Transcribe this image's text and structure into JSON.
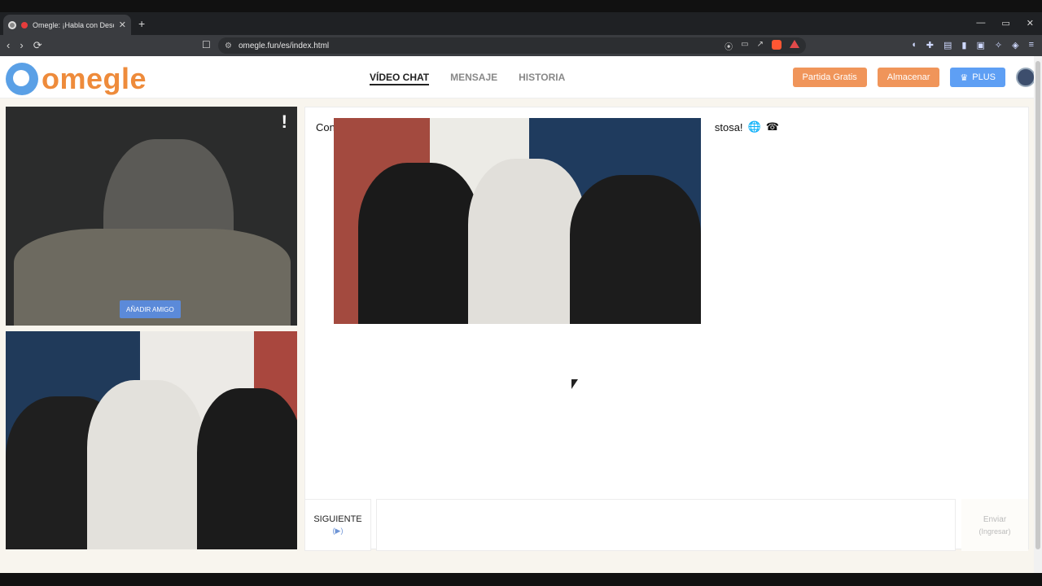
{
  "browser": {
    "tab_title": "Omegle: ¡Habla con Descono",
    "new_tab": "+",
    "url": "omegle.fun/es/index.html"
  },
  "header": {
    "logo_text": "omegle",
    "menu": [
      {
        "label": "VÍDEO CHAT"
      },
      {
        "label": "MENSAJE"
      },
      {
        "label": "HISTORIA"
      }
    ],
    "buttons": {
      "free_game": "Partida Gratis",
      "store": "Almacenar",
      "plus": "PLUS"
    }
  },
  "self_video": {
    "report_symbol": "!",
    "add_friend_label": "AÑADIR AMIGO"
  },
  "chat": {
    "message_left": "Con",
    "message_right": "stosa!"
  },
  "controls": {
    "next_label": "SIGUIENTE",
    "next_hint": "(▶)",
    "send_label": "Enviar",
    "send_hint": "(Ingresar)"
  },
  "colors": {
    "accent_orange": "#ee8b3b",
    "button_orange": "#f0955a",
    "plus_blue": "#5e9ff4",
    "add_friend_blue": "#5b8ad9"
  },
  "icons": {
    "nav": [
      "back-icon",
      "forward-icon",
      "reload-icon"
    ],
    "tab": [
      "site-icon",
      "recording-icon",
      "close-icon"
    ],
    "header": [
      "avatar"
    ]
  }
}
